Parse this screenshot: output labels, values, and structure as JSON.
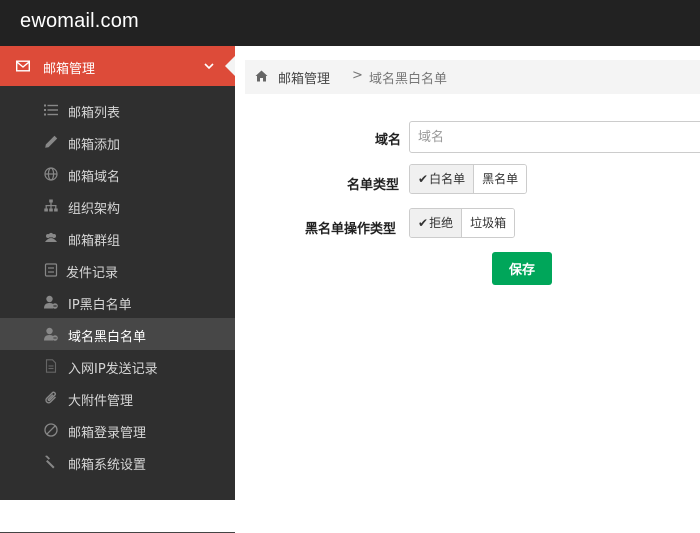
{
  "header": {
    "brand": "ewomail.com"
  },
  "sidebar": {
    "section": {
      "label": "邮箱管理",
      "icon": "envelope-icon"
    },
    "items": [
      {
        "label": "邮箱列表",
        "icon": "list-icon"
      },
      {
        "label": "邮箱添加",
        "icon": "pencil-icon"
      },
      {
        "label": "邮箱域名",
        "icon": "globe-icon"
      },
      {
        "label": "组织架构",
        "icon": "sitemap-icon"
      },
      {
        "label": "邮箱群组",
        "icon": "users-icon"
      },
      {
        "label": "发件记录",
        "icon": "record-icon"
      },
      {
        "label": "IP黑白名单",
        "icon": "user-block-icon"
      },
      {
        "label": "域名黑白名单",
        "icon": "user-block-icon",
        "active": true
      },
      {
        "label": "入网IP发送记录",
        "icon": "file-icon"
      },
      {
        "label": "大附件管理",
        "icon": "paperclip-icon"
      },
      {
        "label": "邮箱登录管理",
        "icon": "ban-icon"
      },
      {
        "label": "邮箱系统设置",
        "icon": "wrench-icon"
      }
    ]
  },
  "breadcrumb": {
    "parent": "邮箱管理",
    "separator": ">",
    "current": "域名黑白名单"
  },
  "form": {
    "domain": {
      "label": "域名",
      "placeholder": "域名",
      "value": ""
    },
    "list_type": {
      "label": "名单类型",
      "options": [
        "白名单",
        "黑名单"
      ],
      "selected": "白名单"
    },
    "blacklist_action": {
      "label": "黑名单操作类型",
      "options": [
        "拒绝",
        "垃圾箱"
      ],
      "selected": "拒绝"
    },
    "save_label": "保存"
  },
  "colors": {
    "accent": "#dd4b39",
    "save": "#00a65a",
    "sidebar": "#2f2f2f",
    "topbar": "#222222"
  }
}
